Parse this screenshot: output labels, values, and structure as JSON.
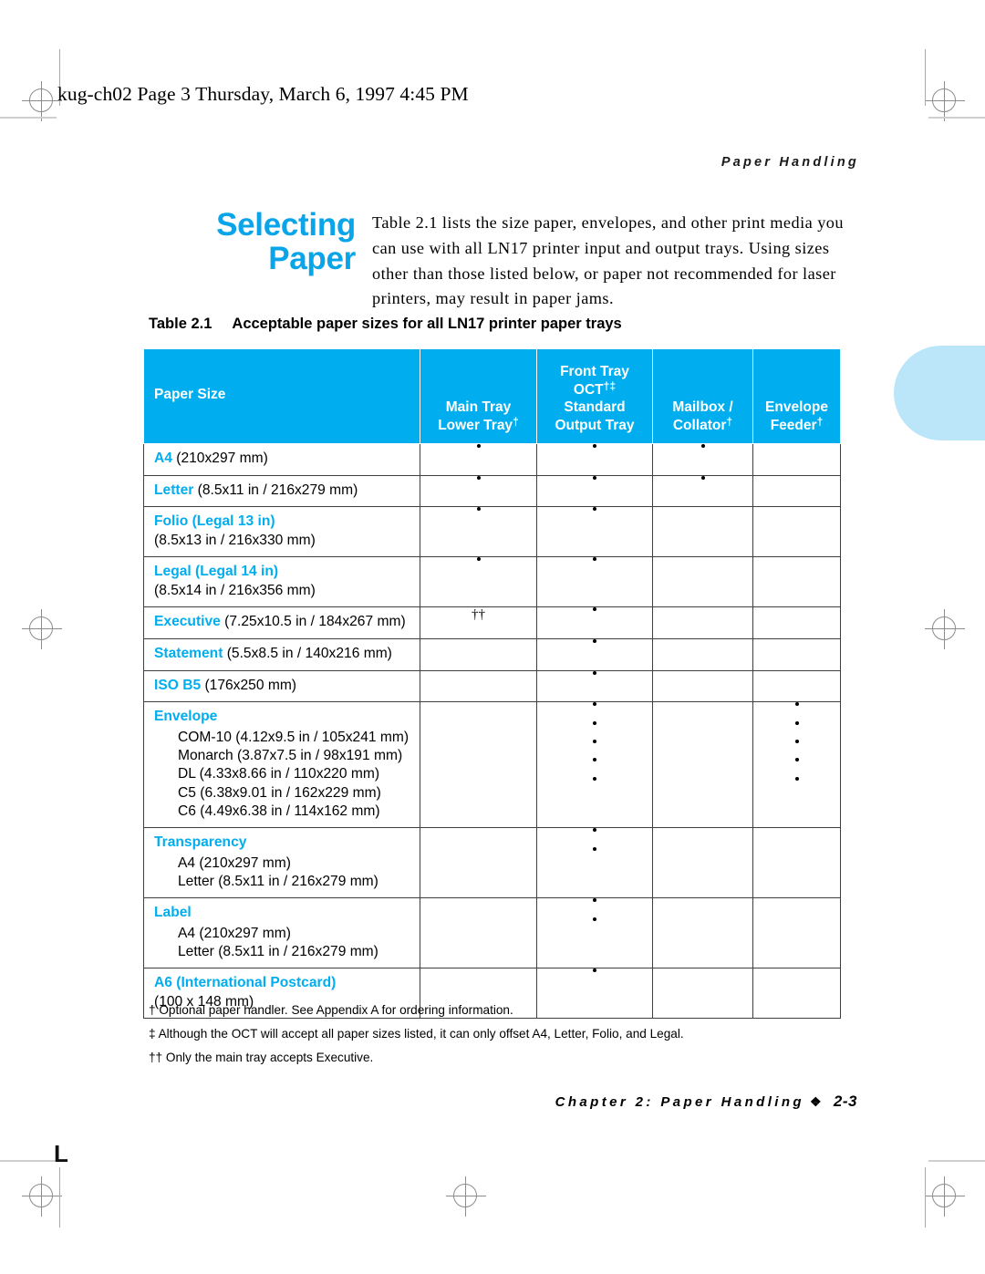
{
  "page_stamp": "kug-ch02  Page 3  Thursday, March 6, 1997  4:45 PM",
  "running_head": "Paper Handling",
  "section": {
    "title_line1": "Selecting",
    "title_line2": "Paper",
    "intro": "Table 2.1 lists the size paper, envelopes, and other print media you can use with all LN17 printer input and output trays. Using sizes other than those listed below, or paper not recommended for laser printers, may result in paper jams."
  },
  "table": {
    "caption_number": "Table 2.1",
    "caption_text": "Acceptable paper sizes for all LN17 printer paper trays",
    "header_color": "#00AEEF",
    "columns": [
      {
        "id": "paper-size",
        "label": "Paper Size"
      },
      {
        "id": "main-tray",
        "line1": "Main Tray",
        "line2": "Lower Tray†"
      },
      {
        "id": "front-tray-oct",
        "line1": "Front Tray",
        "line2": "OCT†‡",
        "line3": "Standard",
        "line4": "Output Tray"
      },
      {
        "id": "mailbox-collator",
        "line1": "Mailbox /",
        "line2": "Collator†"
      },
      {
        "id": "envelope-feeder",
        "line1": "Envelope",
        "line2": "Feeder†"
      }
    ],
    "rows": [
      {
        "id": "a4",
        "name_blue": "A4",
        "name_rest": " (210x297 mm)",
        "marks": [
          "dot",
          "dot",
          "dot",
          ""
        ]
      },
      {
        "id": "letter",
        "name_blue": "Letter",
        "name_rest": " (8.5x11 in / 216x279 mm)",
        "marks": [
          "dot",
          "dot",
          "dot",
          ""
        ]
      },
      {
        "id": "folio",
        "name_blue": "Folio (Legal 13 in)",
        "name_line2": "(8.5x13 in / 216x330 mm)",
        "marks": [
          "dot",
          "dot",
          "",
          ""
        ]
      },
      {
        "id": "legal",
        "name_blue": "Legal (Legal 14 in)",
        "name_line2": "(8.5x14 in / 216x356 mm)",
        "marks": [
          "dot",
          "dot",
          "",
          ""
        ]
      },
      {
        "id": "executive",
        "name_blue": "Executive",
        "name_rest": " (7.25x10.5 in / 184x267 mm)",
        "marks": [
          "dagger2",
          "dot",
          "",
          ""
        ]
      },
      {
        "id": "statement",
        "name_blue": "Statement",
        "name_rest": " (5.5x8.5 in / 140x216 mm)",
        "marks": [
          "",
          "dot",
          "",
          ""
        ]
      },
      {
        "id": "iso-b5",
        "name_blue": "ISO B5",
        "name_rest": " (176x250 mm)",
        "marks": [
          "",
          "dot",
          "",
          ""
        ]
      },
      {
        "id": "envelope",
        "group_blue": "Envelope",
        "sub_items": [
          "COM-10 (4.12x9.5 in / 105x241 mm)",
          "Monarch (3.87x7.5 in / 98x191 mm)",
          "DL (4.33x8.66 in / 110x220 mm)",
          "C5 (6.38x9.01 in / 162x229 mm)",
          "C6 (4.49x6.38 in / 114x162 mm)"
        ],
        "marks": [
          "",
          "dots5",
          "",
          "dots5"
        ]
      },
      {
        "id": "transparency",
        "group_blue": "Transparency",
        "sub_items": [
          "A4 (210x297 mm)",
          "Letter (8.5x11 in / 216x279 mm)"
        ],
        "marks": [
          "",
          "dots2",
          "",
          ""
        ]
      },
      {
        "id": "label",
        "group_blue": "Label",
        "sub_items": [
          "A4 (210x297 mm)",
          "Letter (8.5x11 in / 216x279 mm)"
        ],
        "marks": [
          "",
          "dots2",
          "",
          ""
        ]
      },
      {
        "id": "a6-postcard",
        "name_blue": "A6 (International Postcard)",
        "name_line2": "(100 x 148 mm)",
        "marks": [
          "",
          "dot",
          "",
          ""
        ]
      }
    ]
  },
  "footnotes": [
    "† Optional paper handler. See Appendix A for ordering information.",
    "‡ Although the OCT will accept all paper sizes listed, it can only offset A4, Letter, Folio, and Legal.",
    "†† Only the main tray accepts Executive."
  ],
  "footer": {
    "chapter": "Chapter 2: Paper Handling",
    "diamond": "❖",
    "page_number": "2-3"
  },
  "corner_mark": "L"
}
